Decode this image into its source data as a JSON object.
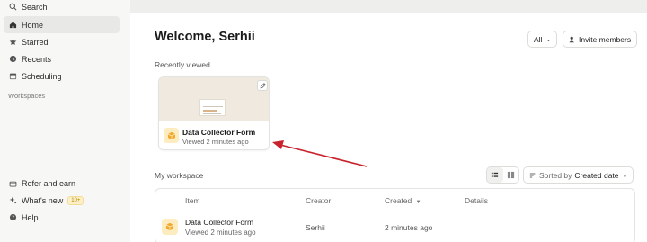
{
  "sidebar": {
    "items": [
      {
        "label": "Search",
        "icon": "search-icon"
      },
      {
        "label": "Home",
        "icon": "home-icon"
      },
      {
        "label": "Starred",
        "icon": "star-icon"
      },
      {
        "label": "Recents",
        "icon": "clock-icon"
      },
      {
        "label": "Scheduling",
        "icon": "calendar-icon"
      }
    ],
    "section_title": "Workspaces",
    "bottom_items": [
      {
        "label": "Refer and earn",
        "icon": "gift-icon"
      },
      {
        "label": "What's new",
        "icon": "sparkle-icon",
        "badge": "10+"
      },
      {
        "label": "Help",
        "icon": "help-icon"
      }
    ]
  },
  "header": {
    "title": "Welcome, Serhii",
    "filter_label": "All",
    "invite_label": "Invite members"
  },
  "recently_viewed": {
    "label": "Recently viewed",
    "card": {
      "name": "Data Collector Form",
      "subtitle": "Viewed 2 minutes ago"
    }
  },
  "workspace": {
    "label": "My workspace",
    "sort_prefix": "Sorted by",
    "sort_value": "Created date",
    "columns": {
      "item": "Item",
      "creator": "Creator",
      "created": "Created",
      "details": "Details"
    },
    "rows": [
      {
        "name": "Data Collector Form",
        "subtitle": "Viewed 2 minutes ago",
        "creator": "Serhii",
        "created": "2 minutes ago",
        "details": ""
      }
    ]
  },
  "colors": {
    "accent_arrow": "#c8232c",
    "form_icon_bg": "#fdecc0",
    "form_icon": "#f0a92e",
    "badge_bg": "#fdf0c8"
  }
}
